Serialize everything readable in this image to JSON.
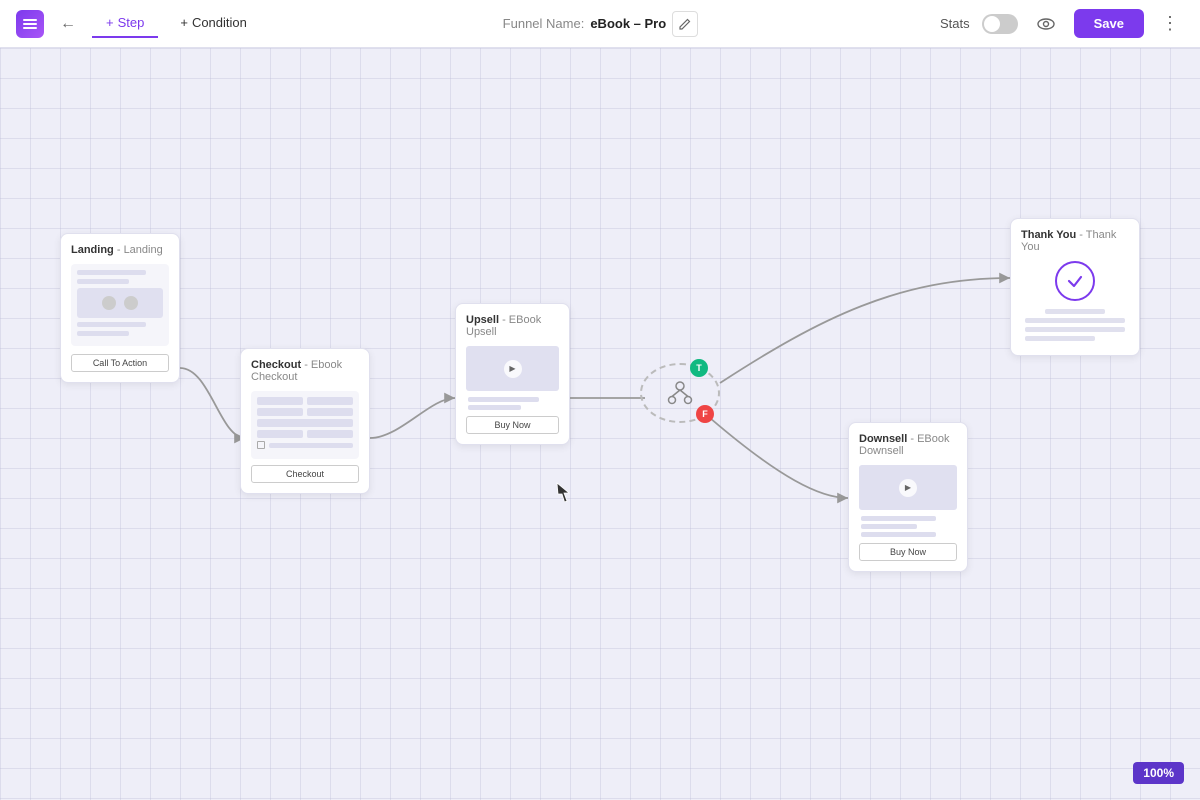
{
  "header": {
    "logo_label": "≡",
    "back_label": "←",
    "tab_step": "Step",
    "tab_step_plus": "+",
    "tab_condition": "Condition",
    "tab_condition_plus": "+",
    "funnel_label": "Funnel Name:",
    "funnel_name": "eBook – Pro",
    "stats_label": "Stats",
    "save_label": "Save",
    "more_label": "⋮"
  },
  "canvas": {
    "zoom": "100%"
  },
  "cards": {
    "landing": {
      "title": "Landing",
      "subtitle": "- Landing",
      "cta": "Call To Action"
    },
    "checkout": {
      "title": "Checkout",
      "subtitle": "- Ebook Checkout",
      "cta": "Checkout"
    },
    "upsell": {
      "title": "Upsell",
      "subtitle": "- EBook Upsell",
      "cta": "Buy Now"
    },
    "thankyou": {
      "title": "Thank You",
      "subtitle": "- Thank You"
    },
    "downsell": {
      "title": "Downsell",
      "subtitle": "- EBook Downsell",
      "cta": "Buy Now"
    }
  },
  "condition": {
    "true_label": "T",
    "false_label": "F"
  }
}
